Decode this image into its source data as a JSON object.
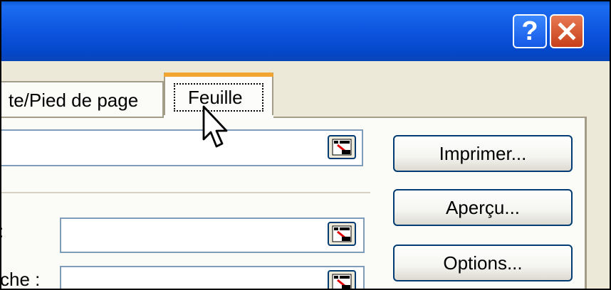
{
  "titlebar": {
    "help_label": "?",
    "help_icon": "help-icon",
    "close_icon": "close-icon"
  },
  "tabs": [
    {
      "label": "te/Pied de page",
      "active": false
    },
    {
      "label": "Feuille",
      "active": true
    }
  ],
  "fields": {
    "print_area": {
      "value": "",
      "picker_icon": "range-picker-icon"
    },
    "rows_repeat_label": ":",
    "rows_repeat": {
      "value": "",
      "picker_icon": "range-picker-icon"
    },
    "cols_repeat_label": "che :",
    "cols_repeat": {
      "value": "",
      "picker_icon": "range-picker-icon"
    }
  },
  "buttons": {
    "print": "Imprimer...",
    "preview": "Aperçu...",
    "options": "Options..."
  },
  "colors": {
    "titlebar": "#0d55de",
    "tab_highlight": "#f3a531",
    "panel": "#fbfbf8",
    "dialog": "#ece9d8"
  }
}
